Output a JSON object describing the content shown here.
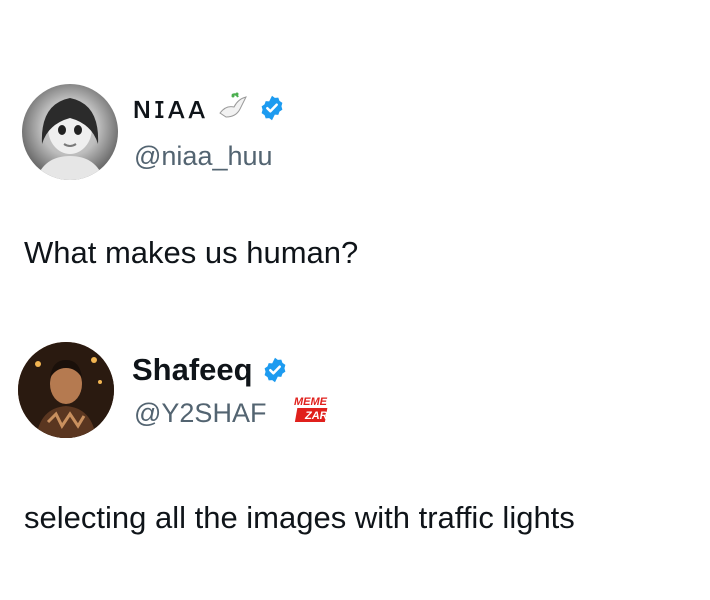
{
  "tweets": [
    {
      "display_name": "ɴɪᴀᴀ",
      "name_icon": "dove-with-olive-branch-icon",
      "verified": true,
      "handle": "@niaa_huu",
      "text": "What makes us human?"
    },
    {
      "display_name": "Shafeeq",
      "verified": true,
      "handle": "@Y2SHAF",
      "text": "selecting all the images with traffic lights"
    }
  ],
  "watermark": {
    "line1": "MEME",
    "line2": "ZAR"
  },
  "colors": {
    "verified_blue": "#1d9bf0",
    "handle_gray": "#536471",
    "text": "#0f1419",
    "watermark_red": "#e0201c"
  }
}
